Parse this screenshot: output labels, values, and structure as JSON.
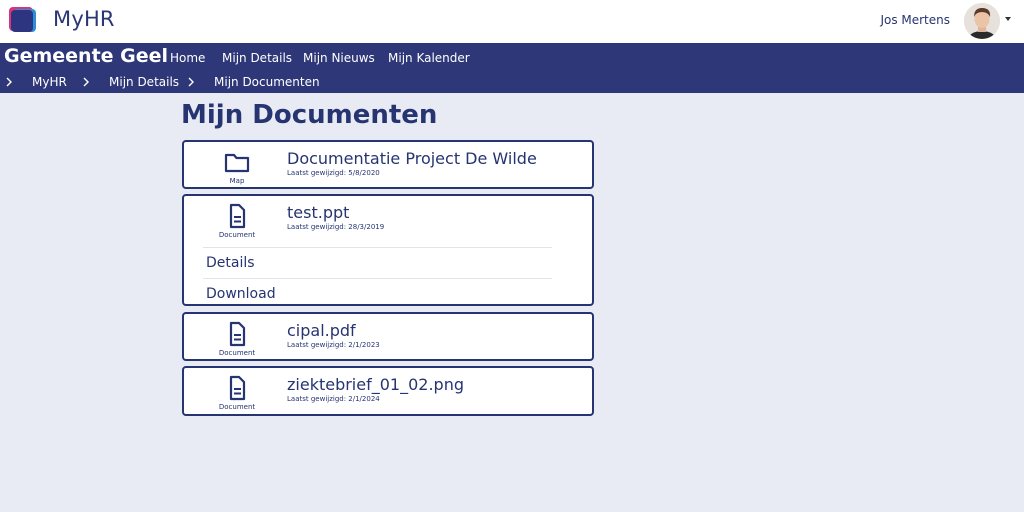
{
  "app": {
    "title": "MyHR",
    "user_name": "Jos Mertens"
  },
  "navbar": {
    "org_name": "Gemeente Geel",
    "items": [
      {
        "label": "Home"
      },
      {
        "label": "Mijn Details"
      },
      {
        "label": "Mijn Nieuws"
      },
      {
        "label": "Mijn Kalender"
      }
    ]
  },
  "breadcrumb": {
    "items": [
      {
        "label": "MyHR"
      },
      {
        "label": "Mijn Details"
      },
      {
        "label": "Mijn Documenten"
      }
    ]
  },
  "main": {
    "title": "Mijn Documenten",
    "items": [
      {
        "name": "Documentatie Project De Wilde",
        "type": "Map",
        "icon": "folder-icon",
        "modified": "Laatst gewijzigd: 5/8/2020"
      },
      {
        "name": "test.ppt",
        "type": "Document",
        "icon": "document-icon",
        "modified": "Laatst gewijzigd: 28/3/2019",
        "expanded": true,
        "actions": [
          {
            "label": "Details"
          },
          {
            "label": "Download"
          }
        ]
      },
      {
        "name": "cipal.pdf",
        "type": "Document",
        "icon": "document-icon",
        "modified": "Laatst gewijzigd: 2/1/2023"
      },
      {
        "name": "ziektebrief_01_02.png",
        "type": "Document",
        "icon": "document-icon",
        "modified": "Laatst gewijzigd: 2/1/2024"
      }
    ]
  },
  "colors": {
    "primary": "#2e3778",
    "text": "#263472",
    "background": "#e9ebf4"
  }
}
